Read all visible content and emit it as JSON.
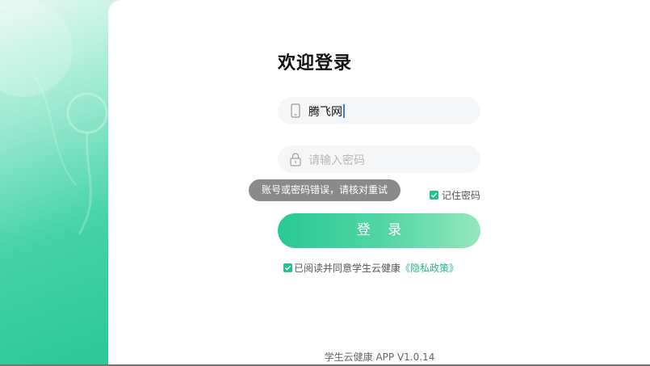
{
  "login": {
    "title": "欢迎登录",
    "username_value": "腾飞网",
    "password_placeholder": "请输入密码",
    "remember_label": "记住密码",
    "login_button": "登 录",
    "agreement_text": "已阅读并同意学生云健康",
    "privacy_link": "《隐私政策》",
    "version": "学生云健康 APP V1.0.14"
  },
  "toast": {
    "message": "账号或密码错误，请核对重试"
  },
  "icons": {
    "username": "phone-icon",
    "password": "lock-icon",
    "remember": "checkbox-checked-icon",
    "agreement": "checkbox-checked-icon"
  },
  "colors": {
    "accent": "#25C090",
    "toast_bg": "#8A8A8A",
    "field_bg": "#F5F6F7"
  }
}
